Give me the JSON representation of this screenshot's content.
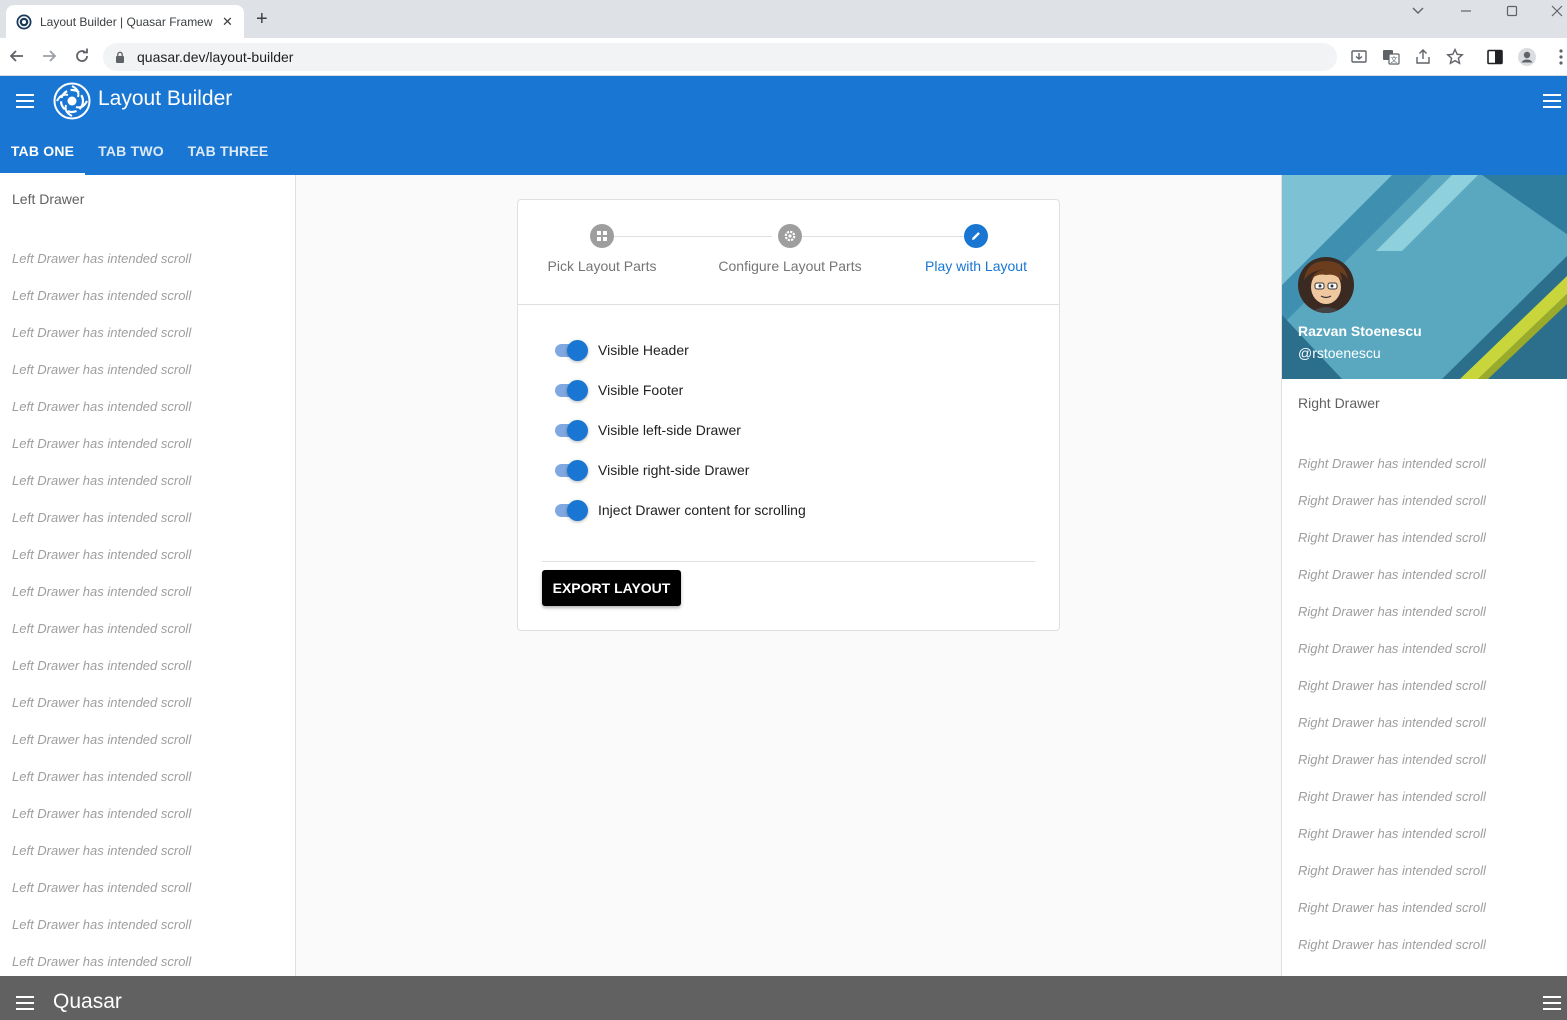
{
  "browser": {
    "tab_title": "Layout Builder | Quasar Framew",
    "url": "quasar.dev/layout-builder"
  },
  "header": {
    "title": "Layout Builder",
    "tabs": [
      {
        "label": "TAB ONE"
      },
      {
        "label": "TAB TWO"
      },
      {
        "label": "TAB THREE"
      }
    ],
    "active_tab": "TAB ONE",
    "color": "#1976d2"
  },
  "left_drawer": {
    "title": "Left Drawer",
    "scroll_text": "Left Drawer has intended scroll"
  },
  "stepper": {
    "steps": [
      {
        "label": "Pick Layout Parts",
        "icon": "grid-icon",
        "active": false
      },
      {
        "label": "Configure Layout Parts",
        "icon": "settings-icon",
        "active": false
      },
      {
        "label": "Play with Layout",
        "icon": "edit-icon",
        "active": true
      }
    ]
  },
  "toggles": [
    {
      "label": "Visible Header",
      "on": true
    },
    {
      "label": "Visible Footer",
      "on": true
    },
    {
      "label": "Visible left-side Drawer",
      "on": true
    },
    {
      "label": "Visible right-side Drawer",
      "on": true
    },
    {
      "label": "Inject Drawer content for scrolling",
      "on": true
    }
  ],
  "export_label": "EXPORT LAYOUT",
  "right_drawer": {
    "profile_name": "Razvan Stoenescu",
    "profile_handle": "@rstoenescu",
    "title": "Right Drawer",
    "scroll_text": "Right Drawer has intended scroll"
  },
  "footer": {
    "title": "Quasar",
    "color": "#616161"
  }
}
